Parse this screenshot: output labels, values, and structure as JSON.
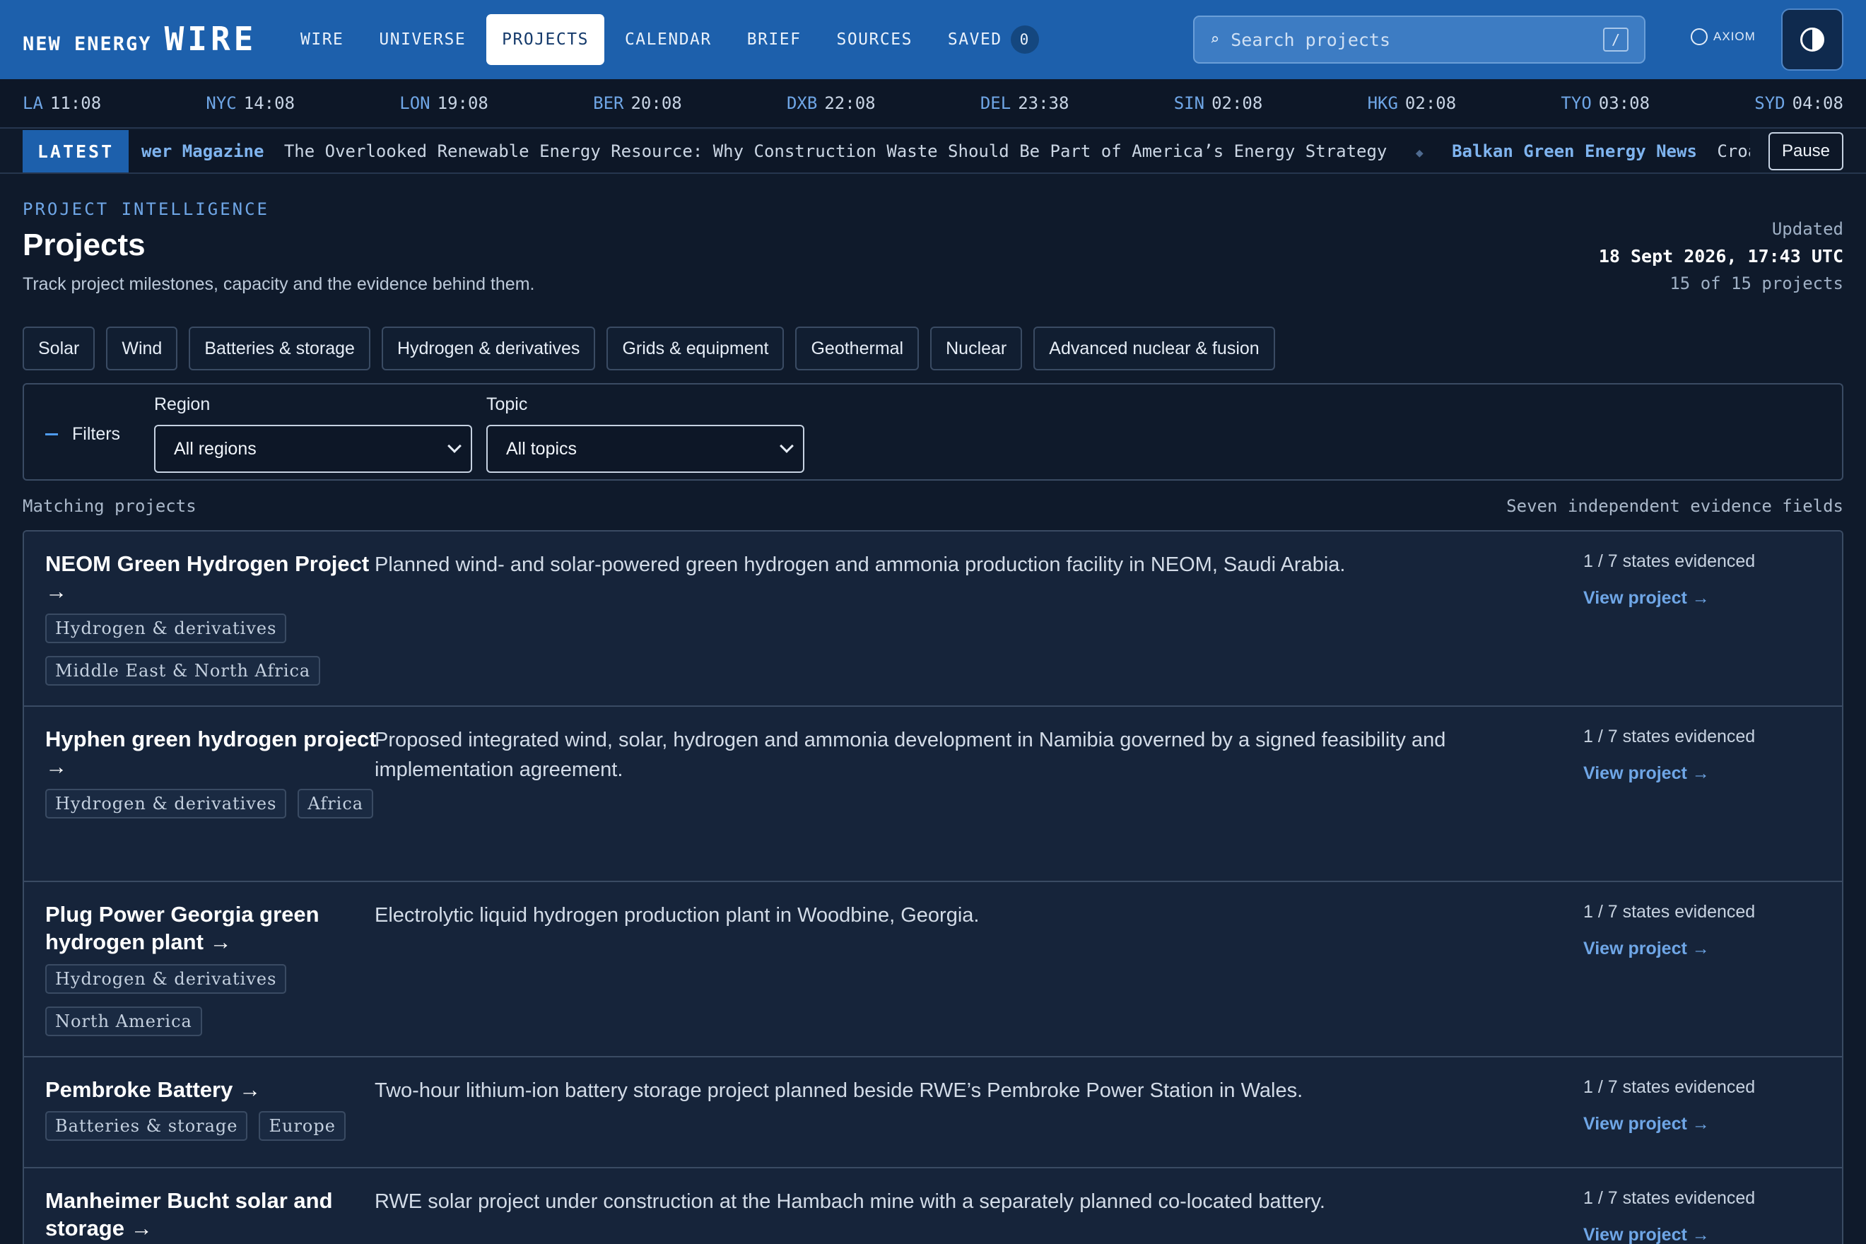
{
  "brand": {
    "part1": "NEW ENERGY",
    "part2": "WIRE"
  },
  "nav": {
    "items": [
      "WIRE",
      "UNIVERSE",
      "PROJECTS",
      "CALENDAR",
      "BRIEF",
      "SOURCES",
      "SAVED"
    ],
    "active": "PROJECTS",
    "saved_count": "0"
  },
  "search": {
    "placeholder": "Search projects",
    "shortcut": "/"
  },
  "partner": {
    "label": "AXIOM"
  },
  "clocks": [
    {
      "city": "LA",
      "time": "11:08"
    },
    {
      "city": "NYC",
      "time": "14:08"
    },
    {
      "city": "LON",
      "time": "19:08"
    },
    {
      "city": "BER",
      "time": "20:08"
    },
    {
      "city": "DXB",
      "time": "22:08"
    },
    {
      "city": "DEL",
      "time": "23:38"
    },
    {
      "city": "SIN",
      "time": "02:08"
    },
    {
      "city": "HKG",
      "time": "02:08"
    },
    {
      "city": "TYO",
      "time": "03:08"
    },
    {
      "city": "SYD",
      "time": "04:08"
    }
  ],
  "ticker": {
    "label": "LATEST",
    "items": [
      {
        "source": "wer Magazine",
        "headline": "The Overlooked Renewable Energy Resource: Why Construction Waste Should Be Part of America’s Energy Strategy"
      },
      {
        "source": "Balkan Green Energy News",
        "headline": "Croatia"
      }
    ],
    "separator": "◆",
    "pause_label": "Pause"
  },
  "header": {
    "eyebrow": "PROJECT INTELLIGENCE",
    "title": "Projects",
    "subtitle": "Track project milestones, capacity and the evidence behind them.",
    "updated_label": "Updated",
    "updated_time": "18 Sept 2026, 17:43 UTC",
    "count": "15 of 15 projects"
  },
  "topics": [
    "Solar",
    "Wind",
    "Batteries & storage",
    "Hydrogen & derivatives",
    "Grids & equipment",
    "Geothermal",
    "Nuclear",
    "Advanced nuclear & fusion"
  ],
  "filters": {
    "toggle_label": "Filters",
    "region_label": "Region",
    "region_value": "All regions",
    "topic_label": "Topic",
    "topic_value": "All topics"
  },
  "list": {
    "matching_label": "Matching projects",
    "evidence_note": "Seven independent evidence fields",
    "projects": [
      {
        "name": "NEOM Green Hydrogen Project →",
        "tags": [
          "Hydrogen & derivatives",
          "Middle East & North Africa"
        ],
        "description": "Planned wind- and solar-powered green hydrogen and ammonia production facility in NEOM, Saudi Arabia.",
        "states": "1 / 7 states evidenced",
        "link": "View project →"
      },
      {
        "name": "Hyphen green hydrogen project →",
        "tags": [
          "Hydrogen & derivatives",
          "Africa"
        ],
        "description": "Proposed integrated wind, solar, hydrogen and ammonia development in Namibia governed by a signed feasibility and implementation agreement.",
        "states": "1 / 7 states evidenced",
        "link": "View project →"
      },
      {
        "name": "Plug Power Georgia green hydrogen plant →",
        "tags": [
          "Hydrogen & derivatives",
          "North America"
        ],
        "description": "Electrolytic liquid hydrogen production plant in Woodbine, Georgia.",
        "states": "1 / 7 states evidenced",
        "link": "View project →"
      },
      {
        "name": "Pembroke Battery →",
        "tags": [
          "Batteries & storage",
          "Europe"
        ],
        "description": "Two-hour lithium-ion battery storage project planned beside RWE’s Pembroke Power Station in Wales.",
        "states": "1 / 7 states evidenced",
        "link": "View project →"
      },
      {
        "name": "Manheimer Bucht solar and storage →",
        "tags": [],
        "description": "RWE solar project under construction at the Hambach mine with a separately planned co-located battery.",
        "states": "1 / 7 states evidenced",
        "link": "View project →"
      }
    ]
  }
}
